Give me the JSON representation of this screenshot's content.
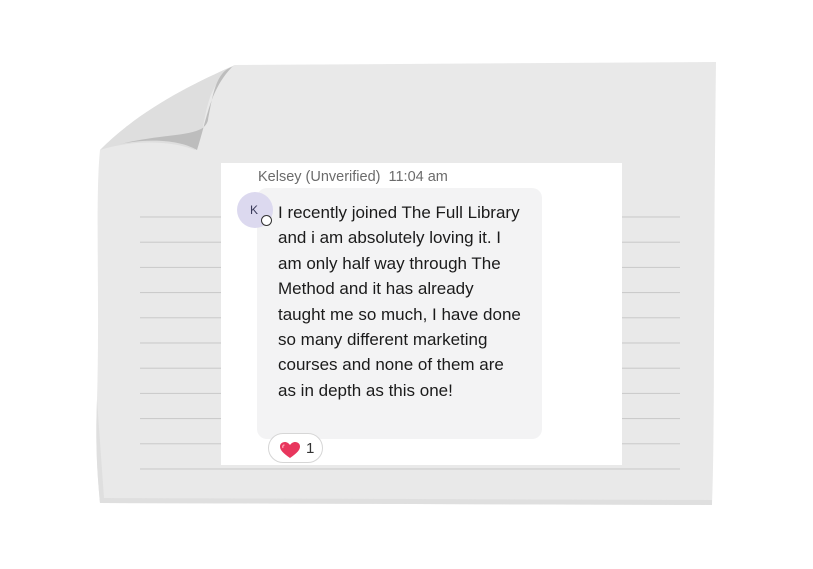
{
  "message": {
    "author": "Kelsey (Unverified)",
    "time": "11:04 am",
    "avatar_initial": "K",
    "text": "I recently joined The Full Library and i am absolutely loving it. I am only half way through The Method and it has already taught me so much, I have done so many different marketing courses and none of them are as in depth as this one!",
    "reaction": {
      "icon": "heart-icon",
      "count": "1"
    }
  },
  "colors": {
    "paper": "#e9e9e9",
    "bubble": "#f3f3f4",
    "avatar": "#dcd9ef",
    "heart": "#e8365d"
  }
}
